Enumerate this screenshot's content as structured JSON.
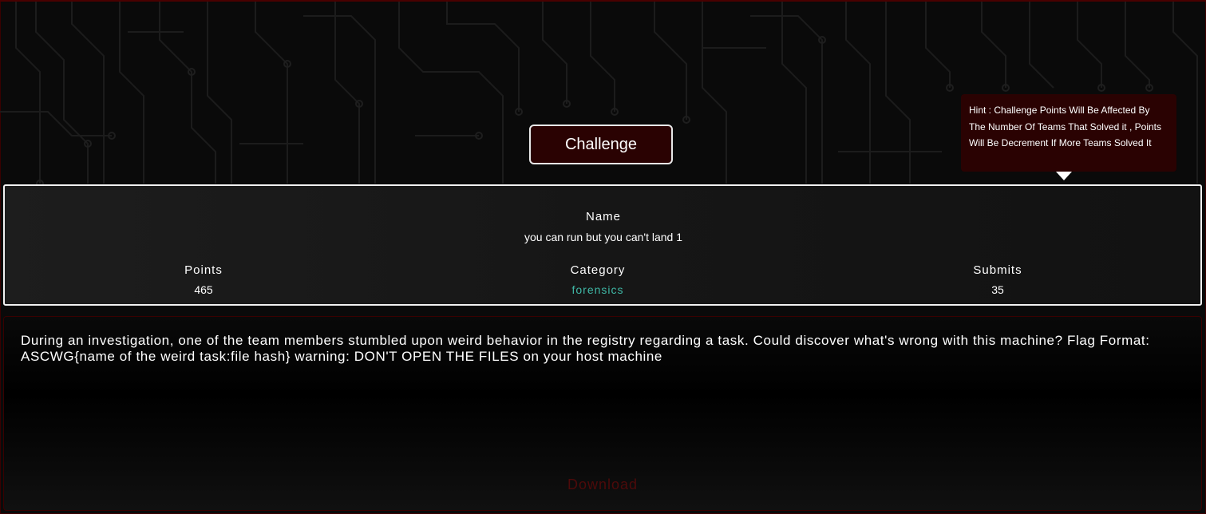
{
  "challenge_button": {
    "label": "Challenge"
  },
  "hint": {
    "text": "Hint : Challenge Points Will Be Affected By The Number Of Teams That Solved it , Points Will Be Decrement If More Teams Solved It"
  },
  "info": {
    "name_label": "Name",
    "name_value": "you can run but you can't land 1",
    "points_label": "Points",
    "points_value": "465",
    "category_label": "Category",
    "category_value": "forensics",
    "submits_label": "Submits",
    "submits_value": "35"
  },
  "description": {
    "text": "During an investigation, one of the team members stumbled upon weird behavior in the registry regarding a task. Could discover what's wrong with this machine? Flag Format: ASCWG{name of the weird task:file hash} warning: DON'T OPEN THE FILES on your host machine",
    "download_label": "Download"
  },
  "colors": {
    "accent_dark_red": "#2a0202",
    "category_teal": "#3fb8a6",
    "download_red": "#4d0a0a",
    "border_white": "#f2f2f2"
  }
}
